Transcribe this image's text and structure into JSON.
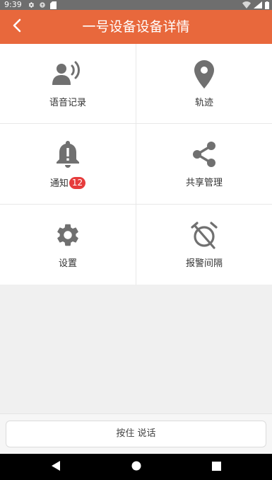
{
  "status_bar": {
    "time": "9:39"
  },
  "header": {
    "title": "一号设备设备详情",
    "back_icon": "chevron-left-icon"
  },
  "menu": {
    "voice_record": {
      "label": "语音记录",
      "icon": "voice-speaker-icon"
    },
    "track": {
      "label": "轨迹",
      "icon": "location-pin-icon"
    },
    "notification": {
      "label": "通知",
      "badge": "12",
      "icon": "bell-icon"
    },
    "share_manage": {
      "label": "共享管理",
      "icon": "share-icon"
    },
    "settings": {
      "label": "设置",
      "icon": "gear-icon"
    },
    "alarm_interval": {
      "label": "报警间隔",
      "icon": "alarm-off-icon"
    }
  },
  "talk": {
    "label": "按住 说话"
  },
  "colors": {
    "accent": "#e8683c",
    "icon_gray": "#707070",
    "badge_red": "#e63c3c",
    "background": "#f0f0f0"
  }
}
